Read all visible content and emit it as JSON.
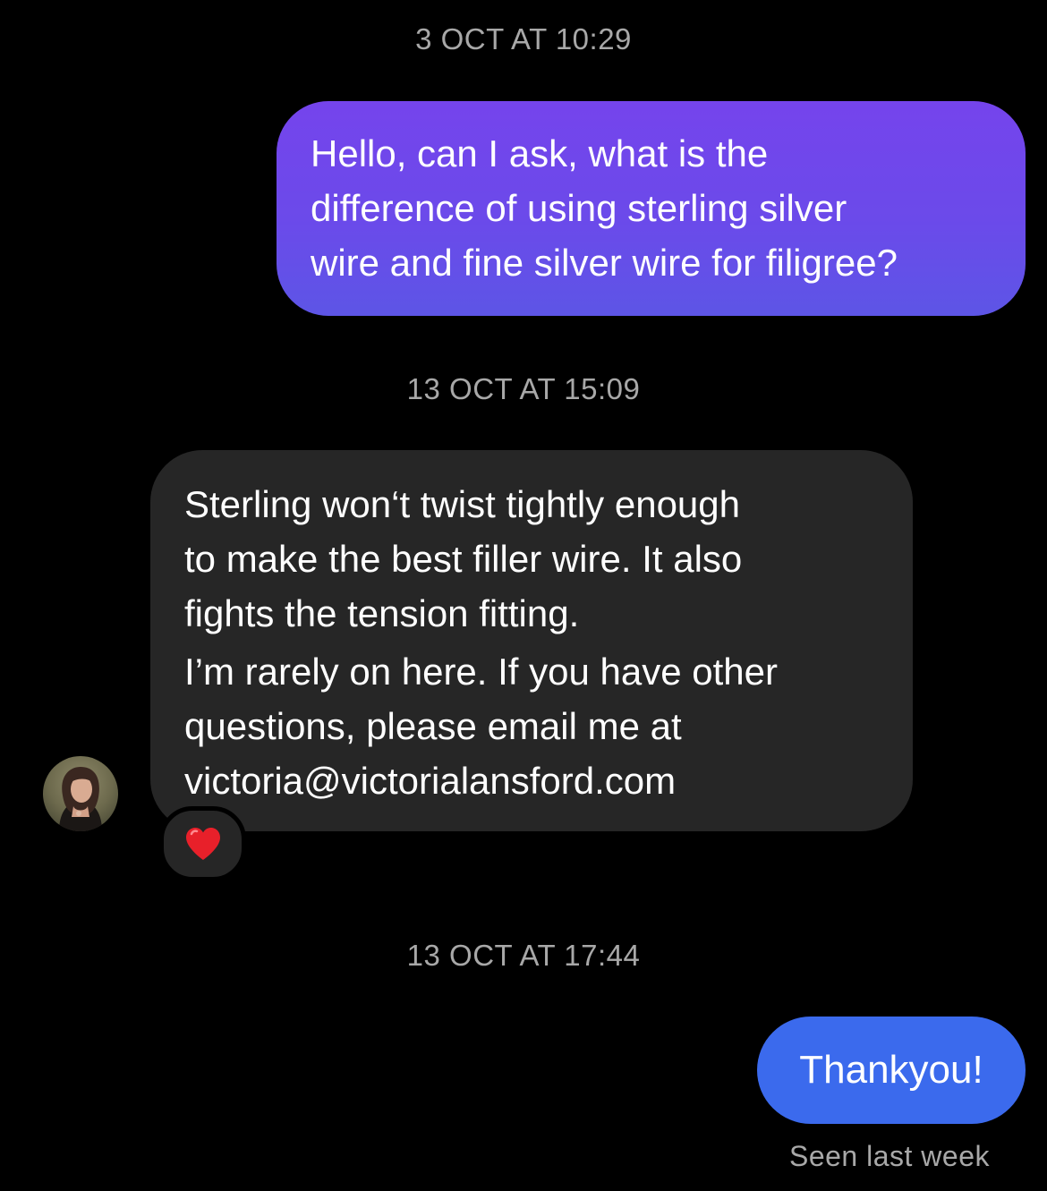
{
  "conversation": {
    "timestamps": [
      "3 OCT AT 10:29",
      "13 OCT AT 15:09",
      "13 OCT AT 17:44"
    ],
    "messages": [
      {
        "direction": "outgoing",
        "lines": [
          "Hello, can I ask, what is the",
          "difference of using sterling silver",
          "wire and fine silver wire for filigree?"
        ]
      },
      {
        "direction": "incoming",
        "paragraph1": [
          "Sterling won‘t twist tightly enough",
          "to make the best filler wire. It also",
          "fights the tension fitting."
        ],
        "paragraph2": [
          "I’m rarely on here. If you have other",
          "questions, please email me at",
          "victoria@victorialansford.com"
        ],
        "reaction": "heart"
      },
      {
        "direction": "outgoing",
        "text": "Thankyou!"
      }
    ],
    "seen_status": "Seen last week"
  },
  "colors": {
    "background": "#000000",
    "outgoing_gradient_top": "#7544ec",
    "outgoing_gradient_bottom": "#5d55e6",
    "outgoing_blue": "#3b6aed",
    "incoming_bubble": "#262626",
    "meta_text": "#a8a8a8",
    "reaction_heart": "#e8202a"
  },
  "icons": {
    "avatar": "contact-avatar-photo",
    "reaction": "red-heart-icon"
  }
}
